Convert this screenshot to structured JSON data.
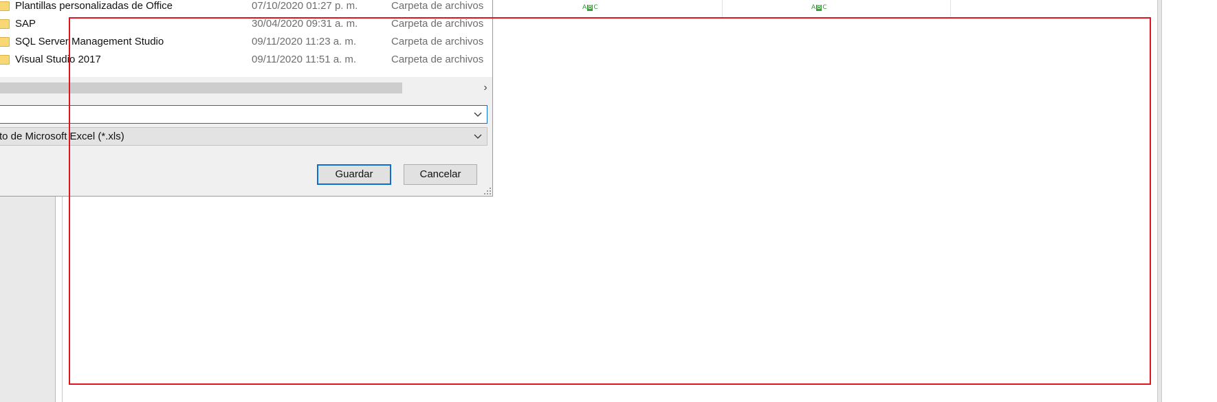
{
  "dialog": {
    "files": [
      {
        "name": "Plantillas personalizadas de Office",
        "date": "07/10/2020 01:27 p. m.",
        "type": "Carpeta de archivos",
        "icon": "folder-icon"
      },
      {
        "name": "SAP",
        "date": "30/04/2020 09:31 a. m.",
        "type": "Carpeta de archivos",
        "icon": "folder-icon"
      },
      {
        "name": "SQL Server Management Studio",
        "date": "09/11/2020 11:23 a. m.",
        "type": "Carpeta de archivos",
        "icon": "folder-icon"
      },
      {
        "name": "Visual Studio 2017",
        "date": "09/11/2020 11:51 a. m.",
        "type": "Carpeta de archivos",
        "icon": "folder-icon"
      }
    ],
    "filename_value": "",
    "save_as_type_value": "to de Microsoft Excel (*.xls)",
    "save_label": "Guardar",
    "cancel_label": "Cancelar"
  },
  "background": {
    "grid_type_icons": [
      "abc-text-icon",
      "abc-text-icon"
    ]
  },
  "colors": {
    "highlight": "#e0141e",
    "focus_blue": "#0a6fd1",
    "folder_yellow": "#f8d775",
    "abc_green": "#3aa03a"
  }
}
